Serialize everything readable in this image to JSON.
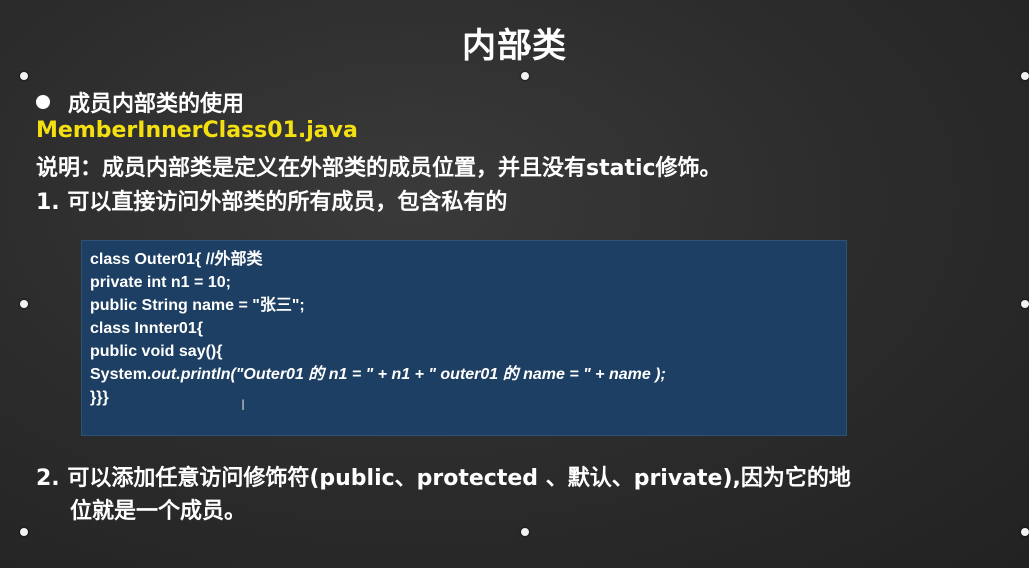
{
  "title": "内部类",
  "section_heading": "成员内部类的使用",
  "filename": "MemberInnerClass01.java",
  "explanation": "说明：成员内部类是定义在外部类的成员位置，并且没有static修饰。",
  "point1": "1. 可以直接访问外部类的所有成员，包含私有的",
  "code_lines": [
    "class Outer01{ //外部类",
    "private int n1 = 10;",
    "public String name = \"张三\";",
    "class Innter01{",
    "public void say(){",
    "System.out.println(\"Outer01 的 n1 = \" + n1 + \" outer01 的 name = \" + name );",
    "}}}"
  ],
  "code_line6_prefix": "System.",
  "code_line6_italic": "out.println(\"Outer01 的 n1 = \" + n1 + \" outer01 的 name = \" + name );",
  "point2_line1": "2. 可以添加任意访问修饰符(public、protected 、默认、private),因为它的地",
  "point2_line2": "位就是一个成员。",
  "text_cursor_glyph": "I"
}
